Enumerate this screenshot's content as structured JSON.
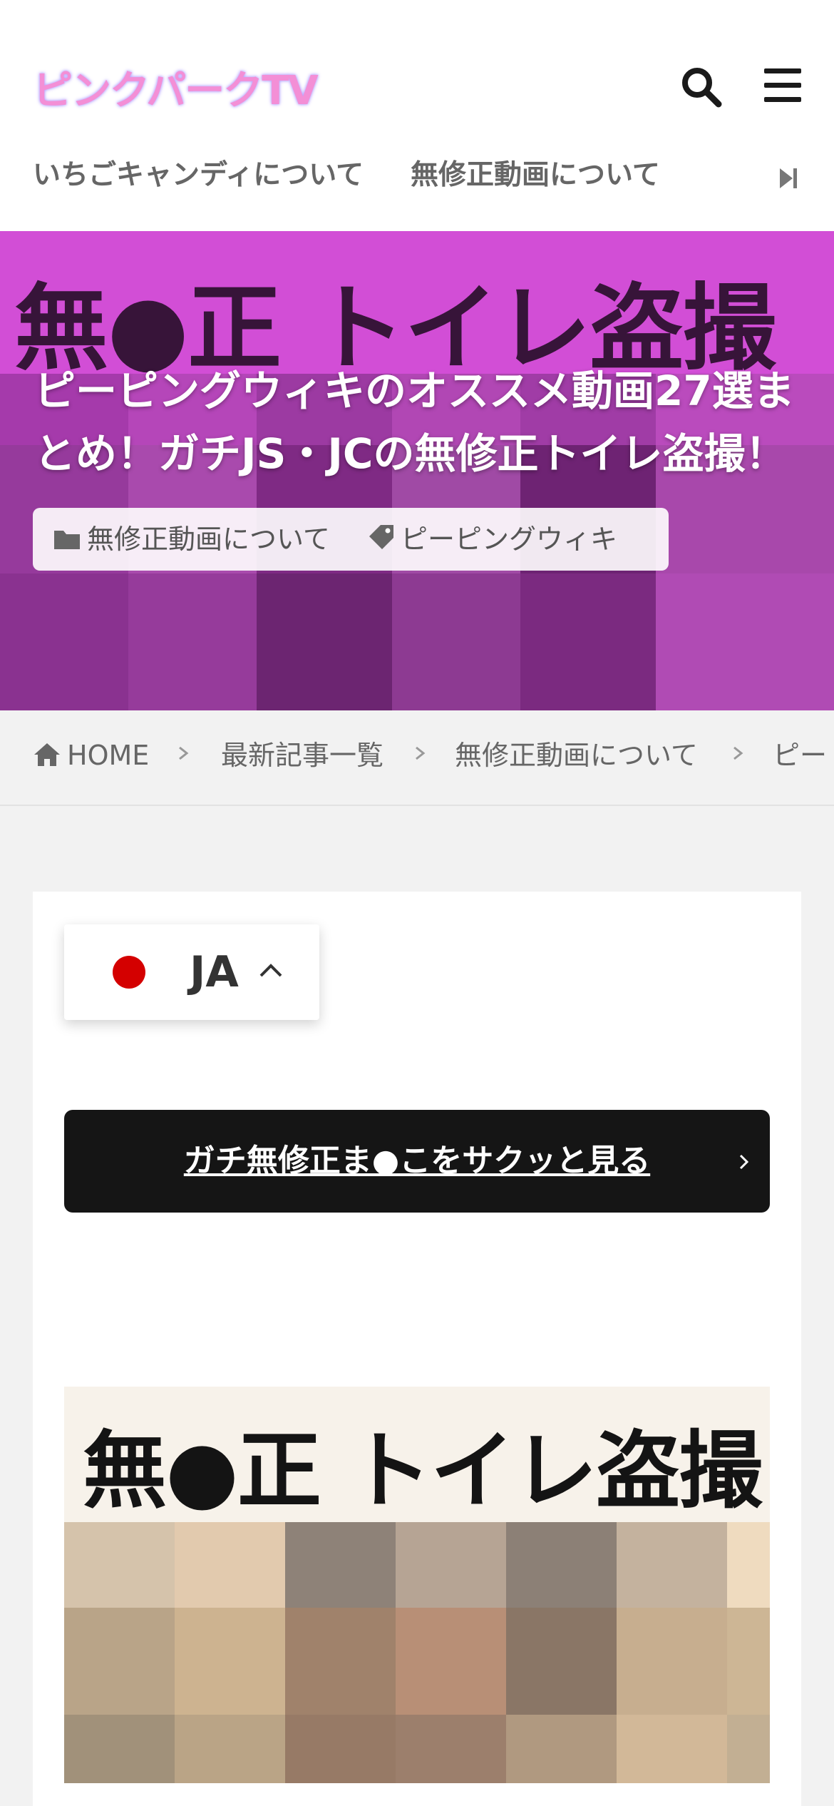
{
  "header": {
    "logo": "ピンクパークTV",
    "nav": [
      "いちごキャンディについて",
      "無修正動画について"
    ]
  },
  "hero": {
    "banner_text": "無●正 トイレ盗撮",
    "title": "ピーピングウィキのオススメ動画27選まとめ！ガチJS・JCの無修正トイレ盗撮！",
    "category": "無修正動画について",
    "tag": "ピーピングウィキ"
  },
  "breadcrumb": [
    "HOME",
    "最新記事一覧",
    "無修正動画について",
    "ピー"
  ],
  "language": {
    "code": "JA"
  },
  "cta": {
    "label": "ガチ無修正ま●こをサクッと見る"
  },
  "thumbnail": {
    "text": "無●正 トイレ盗撮"
  },
  "colors": {
    "logo": "#f38fd6",
    "hero_bg": "#a13aa8",
    "cta_bg": "#151515",
    "flag": "#d40000"
  },
  "icons": {
    "search": "search-icon",
    "menu": "hamburger-menu-icon",
    "nav_scroll": "nav-next-icon",
    "category": "folder-icon",
    "tag": "tag-icon",
    "home": "home-icon",
    "chevron_up": "chevron-up-icon",
    "chevron_right": "chevron-right-icon"
  }
}
